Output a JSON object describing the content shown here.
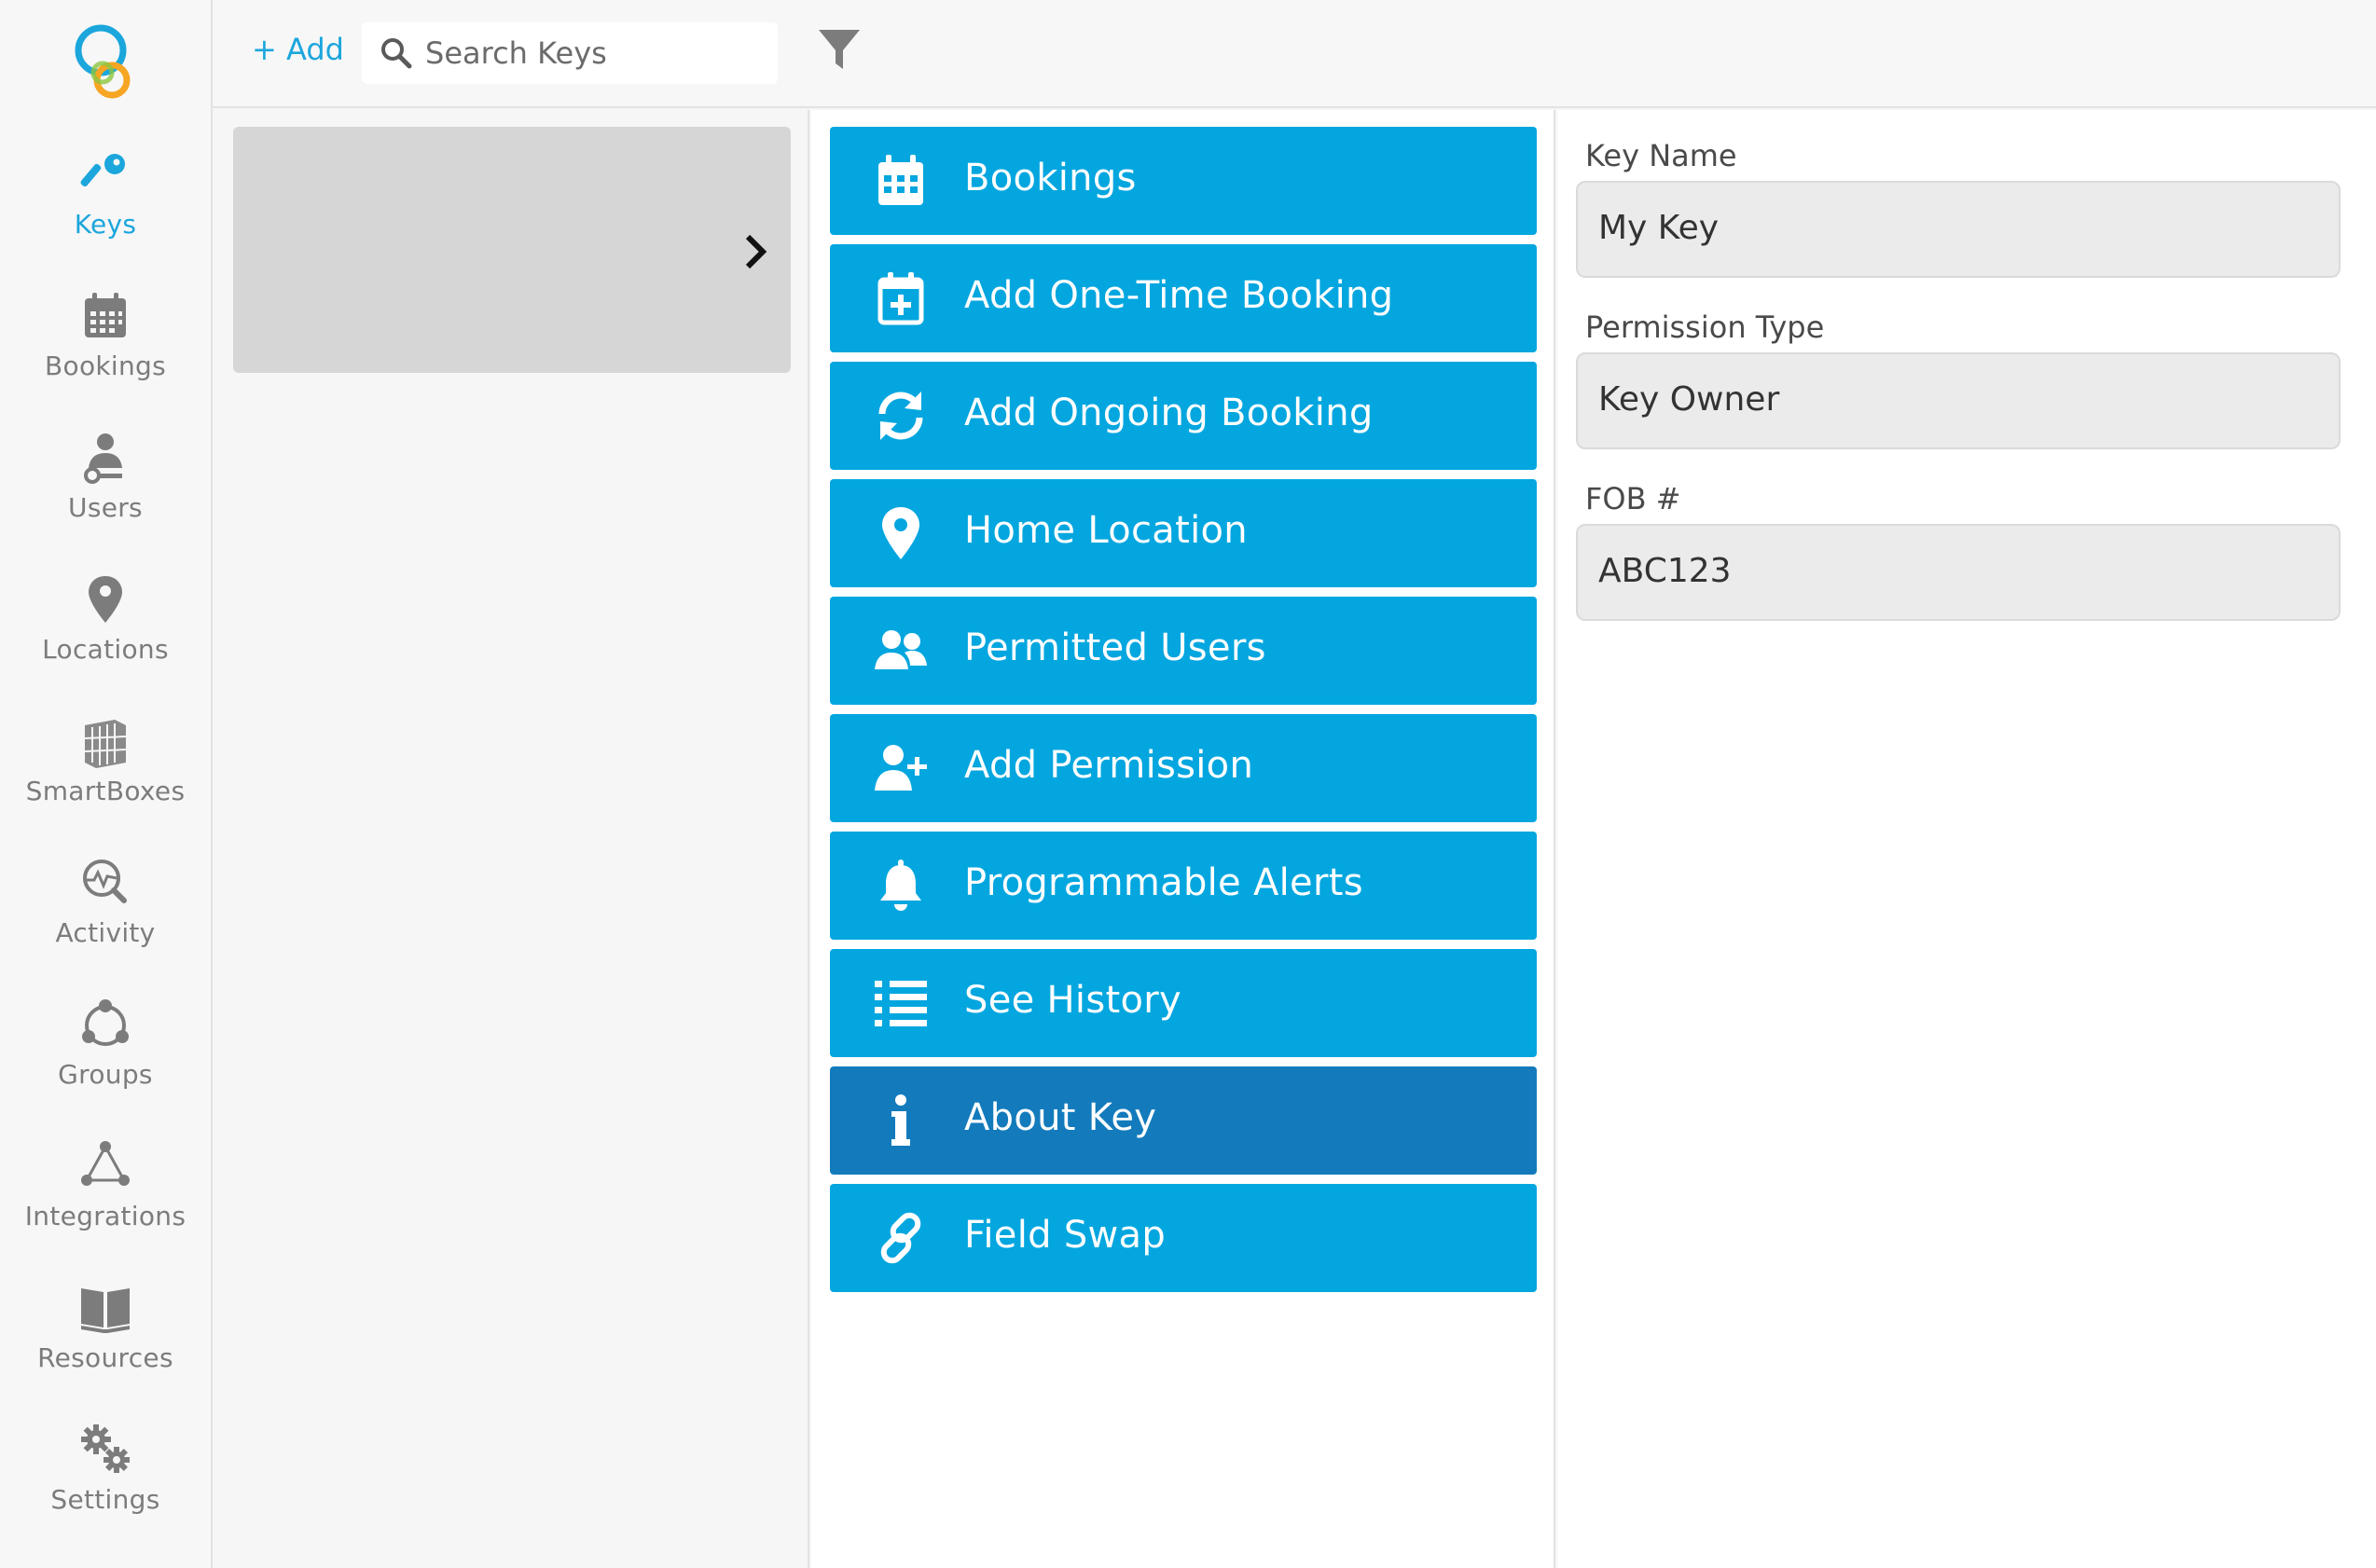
{
  "sidebar": {
    "items": [
      {
        "label": "Keys",
        "icon": "key-icon"
      },
      {
        "label": "Bookings",
        "icon": "calendar-icon"
      },
      {
        "label": "Users",
        "icon": "user-key-icon"
      },
      {
        "label": "Locations",
        "icon": "map-pin-icon"
      },
      {
        "label": "SmartBoxes",
        "icon": "smartbox-icon"
      },
      {
        "label": "Activity",
        "icon": "activity-icon"
      },
      {
        "label": "Groups",
        "icon": "groups-icon"
      },
      {
        "label": "Integrations",
        "icon": "integrations-icon"
      },
      {
        "label": "Resources",
        "icon": "book-icon"
      },
      {
        "label": "Settings",
        "icon": "gear-icon"
      }
    ],
    "active": "Keys"
  },
  "toolbar": {
    "add_label": "+ Add",
    "search_placeholder": "Search Keys"
  },
  "actions": {
    "items": [
      {
        "label": "Bookings",
        "icon": "calendar-icon"
      },
      {
        "label": "Add One-Time Booking",
        "icon": "calendar-plus-icon"
      },
      {
        "label": "Add Ongoing Booking",
        "icon": "refresh-icon"
      },
      {
        "label": "Home Location",
        "icon": "map-pin-icon"
      },
      {
        "label": "Permitted Users",
        "icon": "users-icon"
      },
      {
        "label": "Add Permission",
        "icon": "user-plus-icon"
      },
      {
        "label": "Programmable Alerts",
        "icon": "bell-icon"
      },
      {
        "label": "See History",
        "icon": "list-icon"
      },
      {
        "label": "About Key",
        "icon": "info-icon"
      },
      {
        "label": "Field Swap",
        "icon": "link-icon"
      }
    ],
    "selected": "About Key"
  },
  "details": {
    "key_name_label": "Key Name",
    "key_name": "My Key",
    "permission_type_label": "Permission Type",
    "permission_type": "Key Owner",
    "fob_label": "FOB #",
    "fob": "ABC123"
  },
  "colors": {
    "accent": "#1ba6dc",
    "button": "#03a6df",
    "button_selected": "#137bbc",
    "sidebar_text": "#7c7c7c"
  }
}
